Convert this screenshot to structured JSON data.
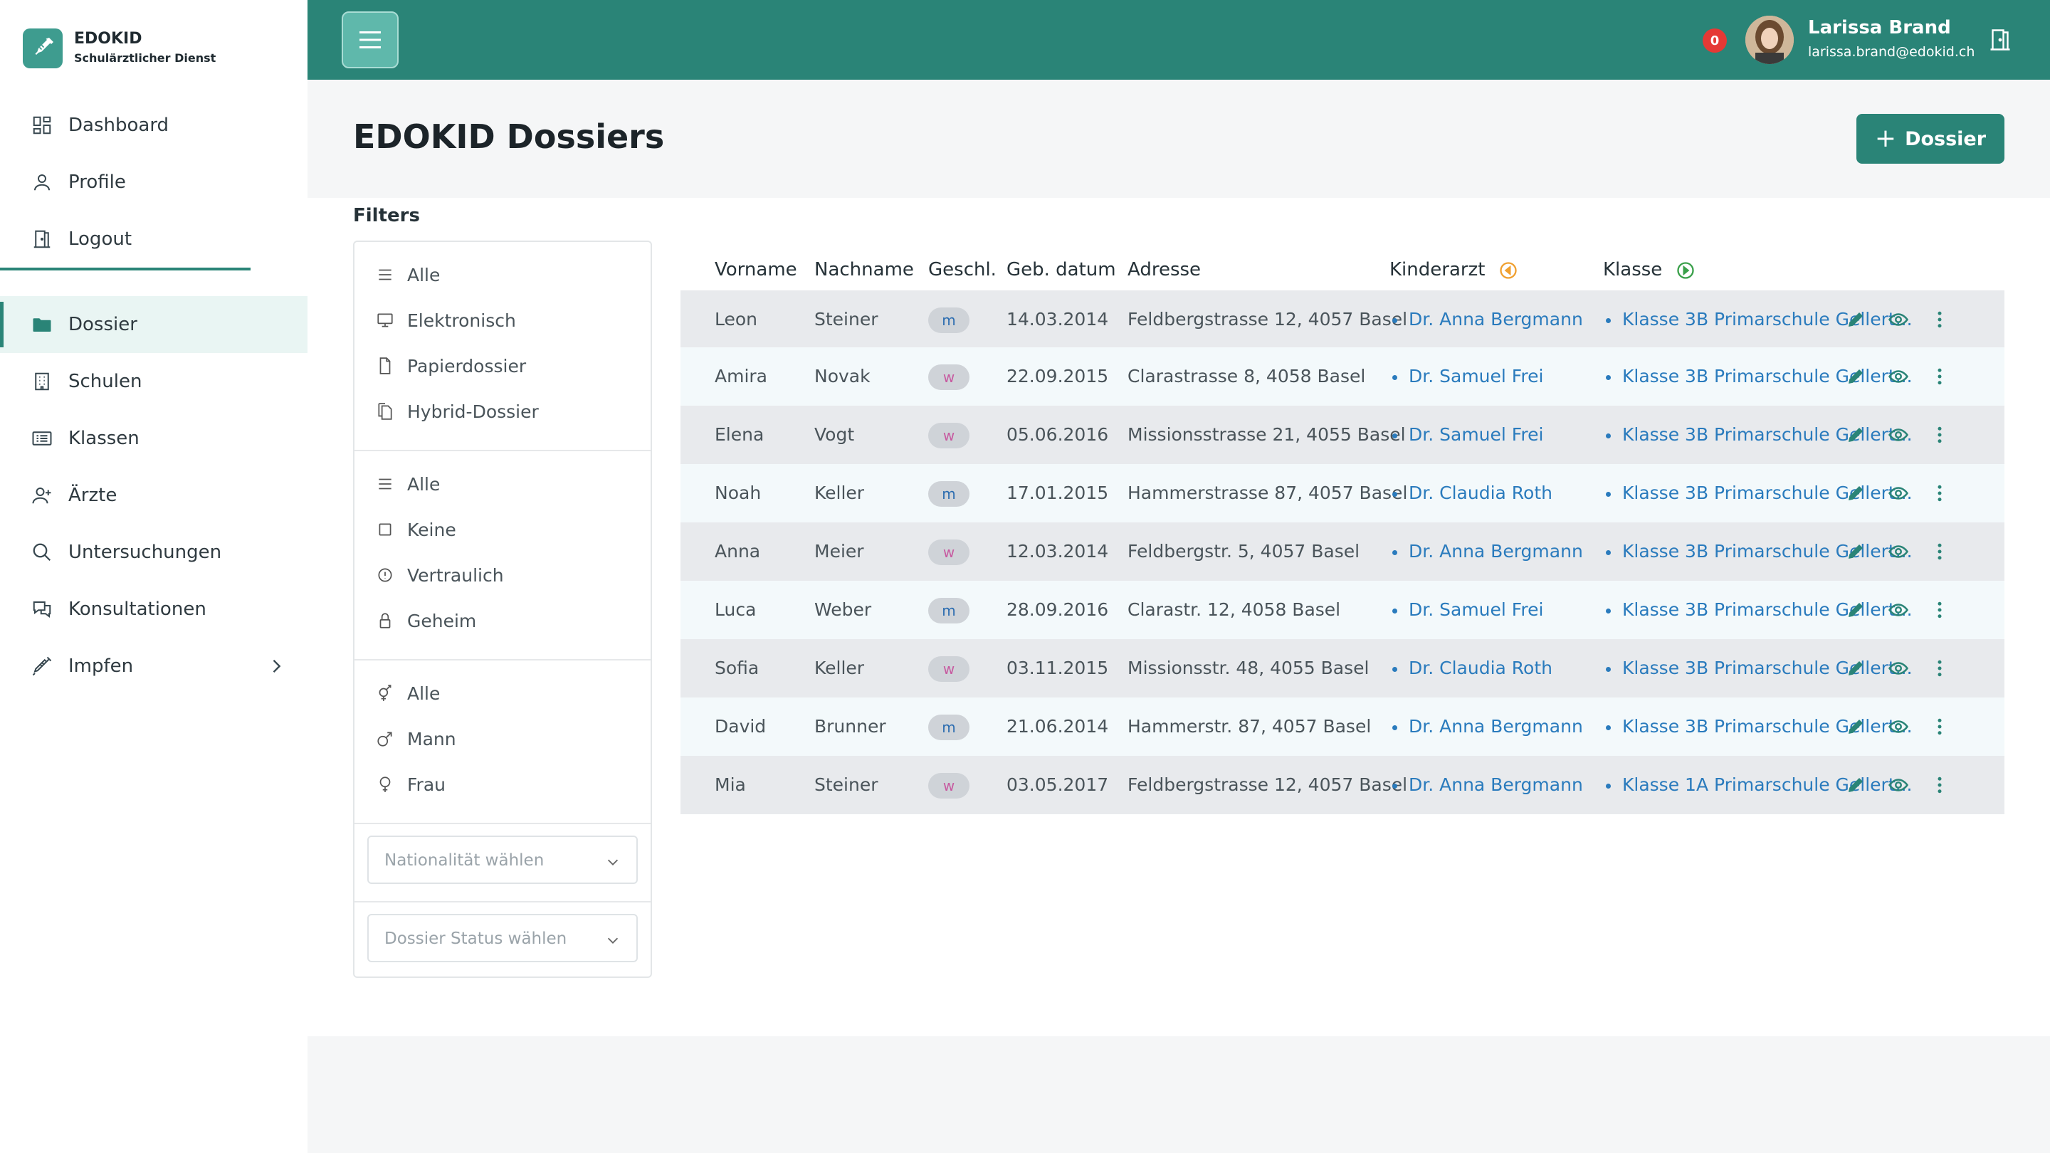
{
  "brand": {
    "name": "EDOKID",
    "subtitle": "Schulärztlicher Dienst"
  },
  "nav_top": [
    {
      "label": "Dashboard",
      "icon": "dashboard-icon"
    },
    {
      "label": "Profile",
      "icon": "user-icon"
    },
    {
      "label": "Logout",
      "icon": "door-icon"
    }
  ],
  "nav_main": [
    {
      "label": "Dossier",
      "icon": "folder-icon",
      "active": true
    },
    {
      "label": "Schulen",
      "icon": "building-icon"
    },
    {
      "label": "Klassen",
      "icon": "class-list-icon"
    },
    {
      "label": "Ärzte",
      "icon": "user-plus-icon"
    },
    {
      "label": "Untersuchungen",
      "icon": "search-icon"
    },
    {
      "label": "Konsultationen",
      "icon": "chat-icon"
    },
    {
      "label": "Impfen",
      "icon": "syringe-icon",
      "has_submenu": true
    }
  ],
  "topbar": {
    "notification_count": "0",
    "user_name": "Larissa Brand",
    "user_email": "larissa.brand@edokid.ch"
  },
  "page": {
    "title": "EDOKID Dossiers",
    "add_button": "Dossier"
  },
  "filters": {
    "label": "Filters",
    "dossier_type": [
      "Alle",
      "Elektronisch",
      "Papierdossier",
      "Hybrid-Dossier"
    ],
    "confidentiality": [
      "Alle",
      "Keine",
      "Vertraulich",
      "Geheim"
    ],
    "gender": [
      "Alle",
      "Mann",
      "Frau"
    ],
    "nationality_placeholder": "Nationalität wählen",
    "status_placeholder": "Dossier Status wählen"
  },
  "table": {
    "headers": [
      "Vorname",
      "Nachname",
      "Geschl.",
      "Geb. datum",
      "Adresse",
      "Kinderarzt",
      "Klasse"
    ],
    "rows": [
      {
        "vorname": "Leon",
        "nachname": "Steiner",
        "geschl": "m",
        "geb": "14.03.2014",
        "adresse": "Feldbergstrasse 12, 4057 Basel",
        "arzt": "Dr. Anna Bergmann",
        "klasse": "Klasse 3B Primarschule Gellert..."
      },
      {
        "vorname": "Amira",
        "nachname": "Novak",
        "geschl": "w",
        "geb": "22.09.2015",
        "adresse": "Clarastrasse 8, 4058 Basel",
        "arzt": "Dr. Samuel Frei",
        "klasse": "Klasse 3B Primarschule Gellert..."
      },
      {
        "vorname": "Elena",
        "nachname": "Vogt",
        "geschl": "w",
        "geb": "05.06.2016",
        "adresse": "Missionsstrasse 21, 4055 Basel",
        "arzt": "Dr. Samuel Frei",
        "klasse": "Klasse 3B Primarschule Gellert..."
      },
      {
        "vorname": "Noah",
        "nachname": "Keller",
        "geschl": "m",
        "geb": "17.01.2015",
        "adresse": "Hammerstrasse 87, 4057 Basel",
        "arzt": "Dr. Claudia Roth",
        "klasse": "Klasse 3B Primarschule Gellert..."
      },
      {
        "vorname": "Anna",
        "nachname": "Meier",
        "geschl": "w",
        "geb": "12.03.2014",
        "adresse": "Feldbergstr. 5, 4057 Basel",
        "arzt": "Dr. Anna Bergmann",
        "klasse": "Klasse 3B Primarschule Gellert..."
      },
      {
        "vorname": "Luca",
        "nachname": "Weber",
        "geschl": "m",
        "geb": "28.09.2016",
        "adresse": "Clarastr. 12, 4058 Basel",
        "arzt": "Dr. Samuel Frei",
        "klasse": "Klasse 3B Primarschule Gellert..."
      },
      {
        "vorname": "Sofia",
        "nachname": "Keller",
        "geschl": "w",
        "geb": "03.11.2015",
        "adresse": "Missionsstr. 48, 4055 Basel",
        "arzt": "Dr. Claudia Roth",
        "klasse": "Klasse 3B Primarschule Gellert..."
      },
      {
        "vorname": "David",
        "nachname": "Brunner",
        "geschl": "m",
        "geb": "21.06.2014",
        "adresse": "Hammerstr. 87, 4057 Basel",
        "arzt": "Dr. Anna Bergmann",
        "klasse": "Klasse 3B Primarschule Gellert..."
      },
      {
        "vorname": "Mia",
        "nachname": "Steiner",
        "geschl": "w",
        "geb": "03.05.2017",
        "adresse": "Feldbergstrasse 12, 4057 Basel",
        "arzt": "Dr. Anna Bergmann",
        "klasse": "Klasse 1A Primarschule Gellert..."
      }
    ]
  },
  "colors": {
    "primary": "#2a8477",
    "link": "#2a7bbd",
    "notification": "#e53935",
    "kinderarzt_icon": "#f0a030",
    "klasse_icon": "#3aa04a"
  }
}
